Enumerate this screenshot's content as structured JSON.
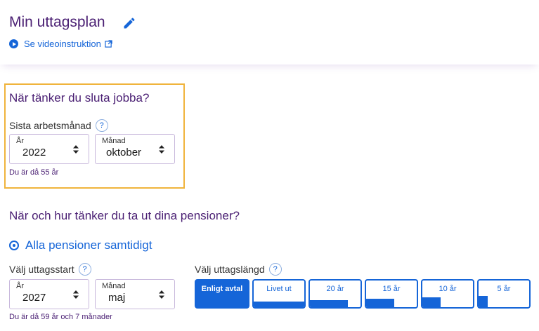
{
  "header": {
    "title": "Min uttagsplan",
    "video_link": "Se videoinstruktion"
  },
  "stop_work": {
    "heading": "När tänker du sluta jobba?",
    "field_label": "Sista arbetsmånad",
    "help": "?",
    "year": {
      "label": "År",
      "value": "2022"
    },
    "month": {
      "label": "Månad",
      "value": "oktober"
    },
    "age_note": "Du är då 55 år"
  },
  "withdrawal": {
    "heading": "När och hur tänker du ta ut dina pensioner?",
    "option_label": "Alla pensioner samtidigt",
    "start": {
      "label": "Välj uttagsstart",
      "help": "?",
      "year": {
        "label": "År",
        "value": "2027"
      },
      "month": {
        "label": "Månad",
        "value": "maj"
      },
      "age_note": "Du är då 59 år och 7 månader"
    },
    "length": {
      "label": "Välj uttagslängd",
      "help": "?",
      "options": [
        {
          "label": "Enligt avtal",
          "selected": true,
          "fill": 0
        },
        {
          "label": "Livet ut",
          "selected": false,
          "fill": 1.0
        },
        {
          "label": "20 år",
          "selected": false,
          "fill": 0.75
        },
        {
          "label": "15 år",
          "selected": false,
          "fill": 0.55
        },
        {
          "label": "10 år",
          "selected": false,
          "fill": 0.36
        },
        {
          "label": "5 år",
          "selected": false,
          "fill": 0.18
        }
      ]
    }
  },
  "colors": {
    "brand_purple": "#4a1f73",
    "accent_blue": "#1565d8",
    "highlight": "#f0b43c"
  }
}
